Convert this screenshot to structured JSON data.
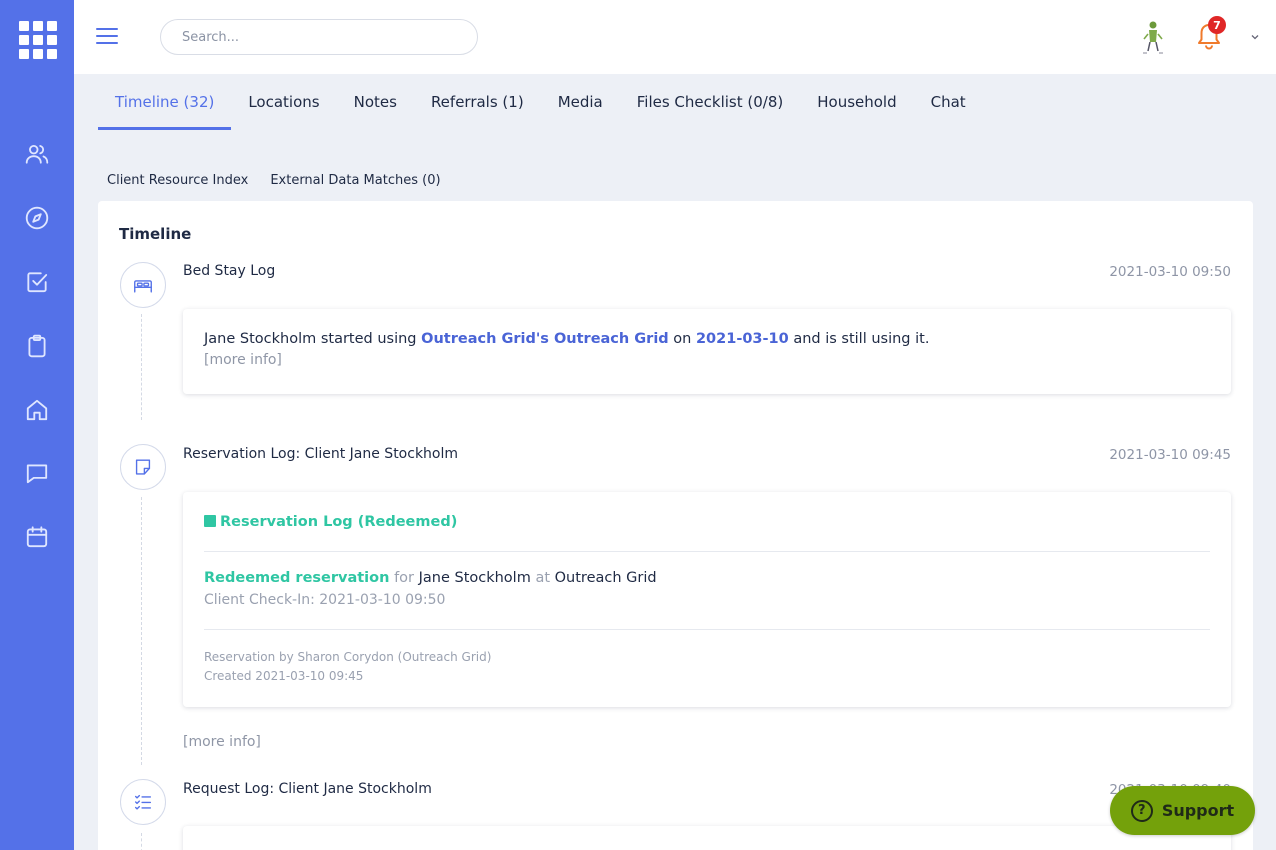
{
  "topbar": {
    "search_placeholder": "Search...",
    "notification_count": "7"
  },
  "sidebar": {
    "icons": [
      "users-icon",
      "compass-icon",
      "checkbox-icon",
      "clipboard-icon",
      "home-icon",
      "chat-icon",
      "calendar-icon"
    ]
  },
  "tabs": [
    {
      "label": "Timeline (32)",
      "active": true
    },
    {
      "label": "Locations"
    },
    {
      "label": "Notes"
    },
    {
      "label": "Referrals (1)"
    },
    {
      "label": "Media"
    },
    {
      "label": "Files Checklist (0/8)"
    },
    {
      "label": "Household"
    },
    {
      "label": "Chat"
    }
  ],
  "subtabs": [
    "Client Resource Index",
    "External Data Matches (0)"
  ],
  "timeline": {
    "title": "Timeline",
    "entries": [
      {
        "icon": "bed-icon",
        "title": "Bed Stay Log",
        "time": "2021-03-10 09:50",
        "body": {
          "prefix": "Jane Stockholm started using ",
          "location": "Outreach Grid's Outreach Grid",
          "mid": " on ",
          "date": "2021-03-10",
          "suffix": " and is still using it."
        },
        "more": "[more info]"
      },
      {
        "icon": "note-icon",
        "title": "Reservation Log: Client Jane Stockholm",
        "time": "2021-03-10 09:45",
        "heading": "Reservation Log (Redeemed)",
        "status": "Redeemed reservation",
        "for_word": "for",
        "client": "Jane Stockholm",
        "at_word": "at",
        "place": "Outreach Grid",
        "checkin": "Client Check-In: 2021-03-10 09:50",
        "reserved_by": "Reservation by Sharon Corydon (Outreach Grid)",
        "created": "Created 2021-03-10 09:45",
        "more": "[more info]"
      },
      {
        "icon": "checklist-icon",
        "title": "Request Log: Client Jane Stockholm",
        "time": "2021-03-10 09:40"
      }
    ]
  },
  "support_label": "Support",
  "colors": {
    "sidebar": "#5471e8",
    "accent": "#5471e8",
    "green": "#2fc6a3",
    "support": "#74a10b",
    "badge": "#e02727"
  }
}
